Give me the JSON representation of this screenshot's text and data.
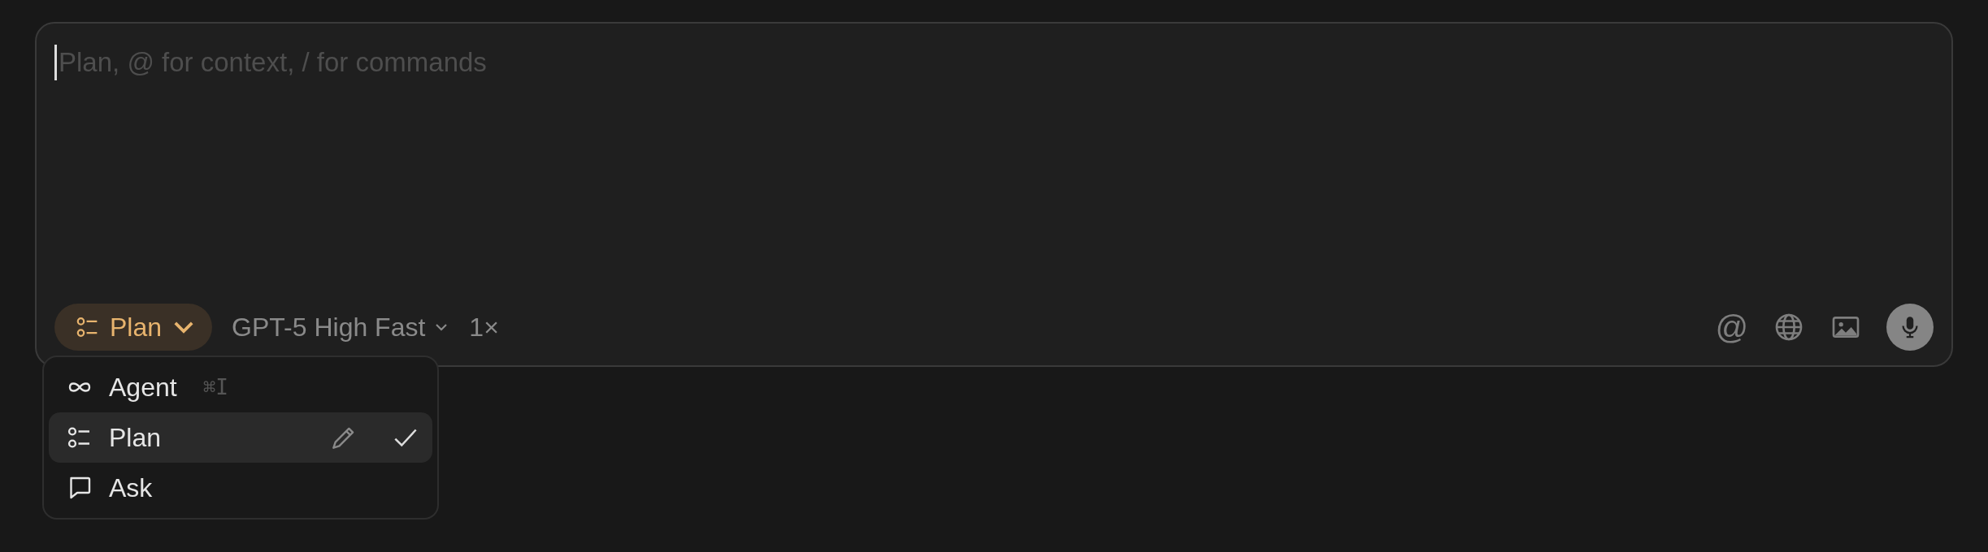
{
  "composer": {
    "placeholder": "Plan, @ for context, / for commands",
    "mode_button": {
      "label": "Plan"
    },
    "model_button": {
      "label": "GPT-5 High Fast"
    },
    "multiplier": "1×",
    "mention_button": {
      "label": "@"
    }
  },
  "mode_menu": {
    "items": [
      {
        "label": "Agent",
        "shortcut": "⌘I",
        "selected": false
      },
      {
        "label": "Plan",
        "selected": true
      },
      {
        "label": "Ask",
        "selected": false
      }
    ]
  }
}
